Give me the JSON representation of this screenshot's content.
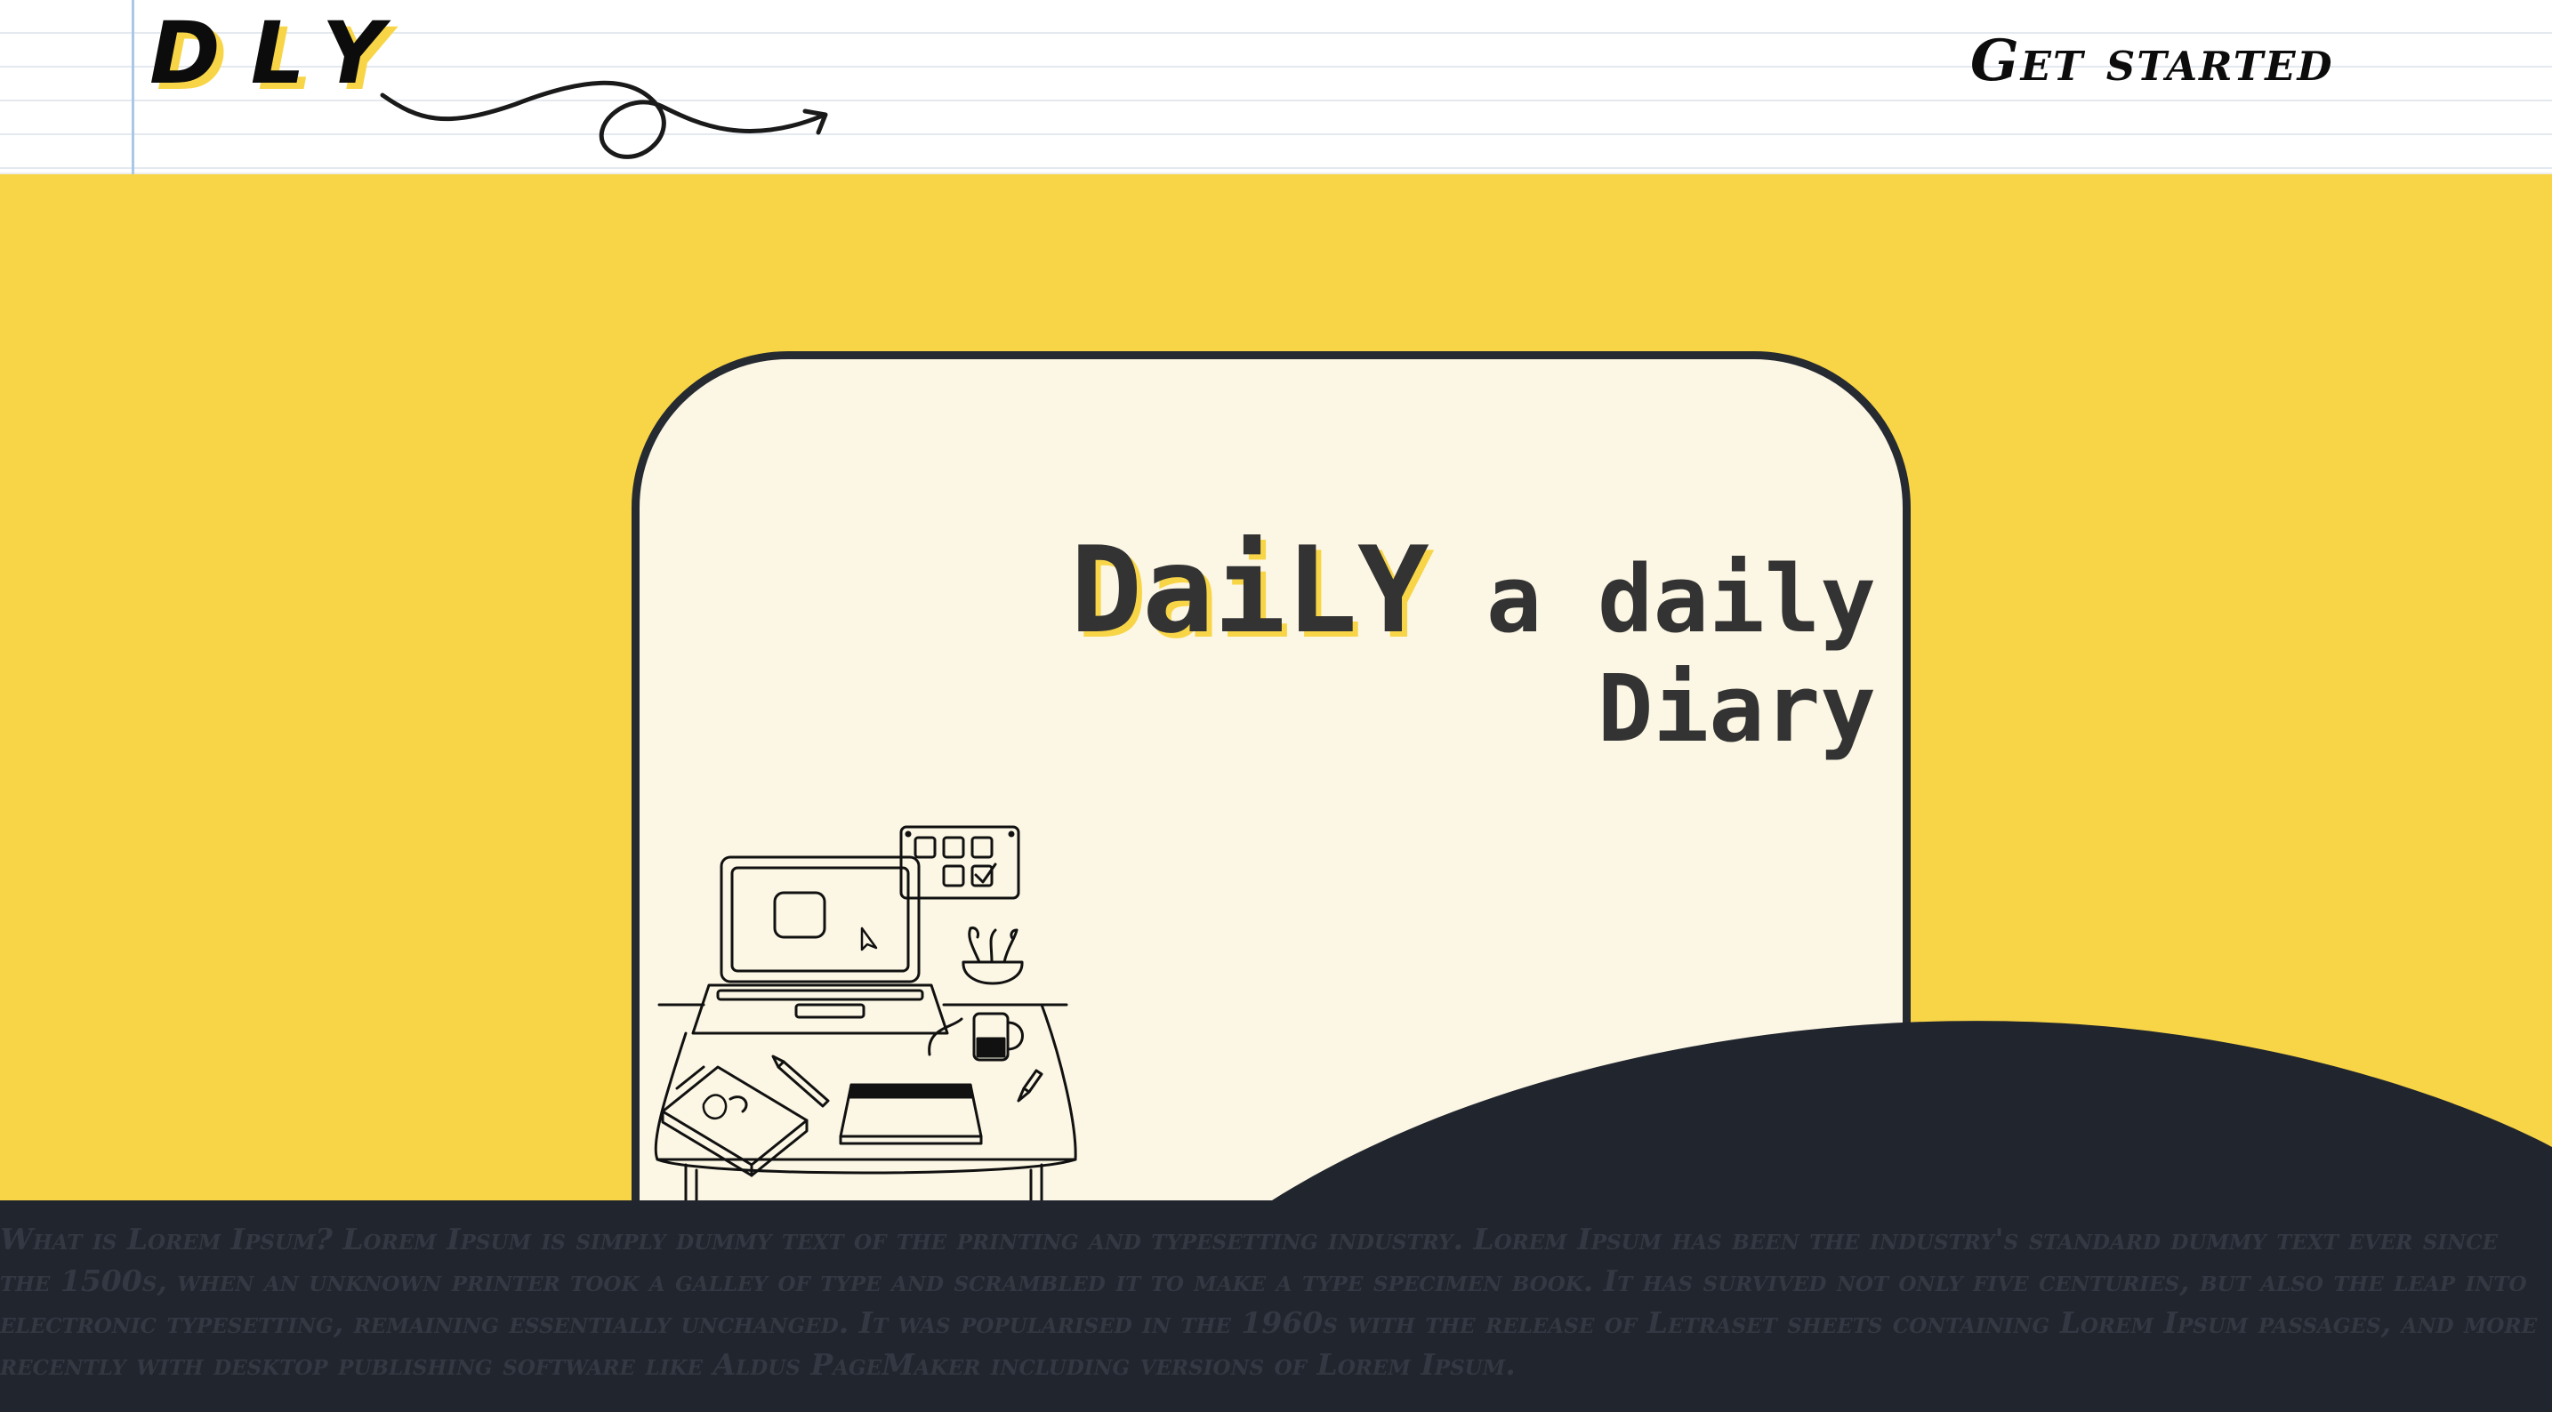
{
  "header": {
    "logo": "DLY",
    "cta_label": "Get started"
  },
  "hero": {
    "brand_word": "DaiLY",
    "tagline": "a daily Diary"
  },
  "footer": {
    "lorem_text": "What is Lorem Ipsum? Lorem Ipsum is simply dummy text of the printing and typesetting industry. Lorem Ipsum has been the industry's standard dummy text ever since the 1500s, when an unknown printer took a galley of type and scrambled it to make a type specimen book. It has survived not only five centuries, but also the leap into electronic typesetting, remaining essentially unchanged. It was popularised in the 1960s with the release of Letraset sheets containing Lorem Ipsum passages, and more recently with desktop publishing software like Aldus PageMaker including versions of Lorem Ipsum."
  },
  "icons": {
    "decorative_arrow": "squiggle-arrow-icon",
    "illustration": "desk-workspace-illustration"
  },
  "colors": {
    "accent_yellow": "#f8d547",
    "dark_navy": "#20252e",
    "card_cream": "#fcf7e4",
    "ink": "#0c0c0c",
    "title_gray": "#333333"
  }
}
